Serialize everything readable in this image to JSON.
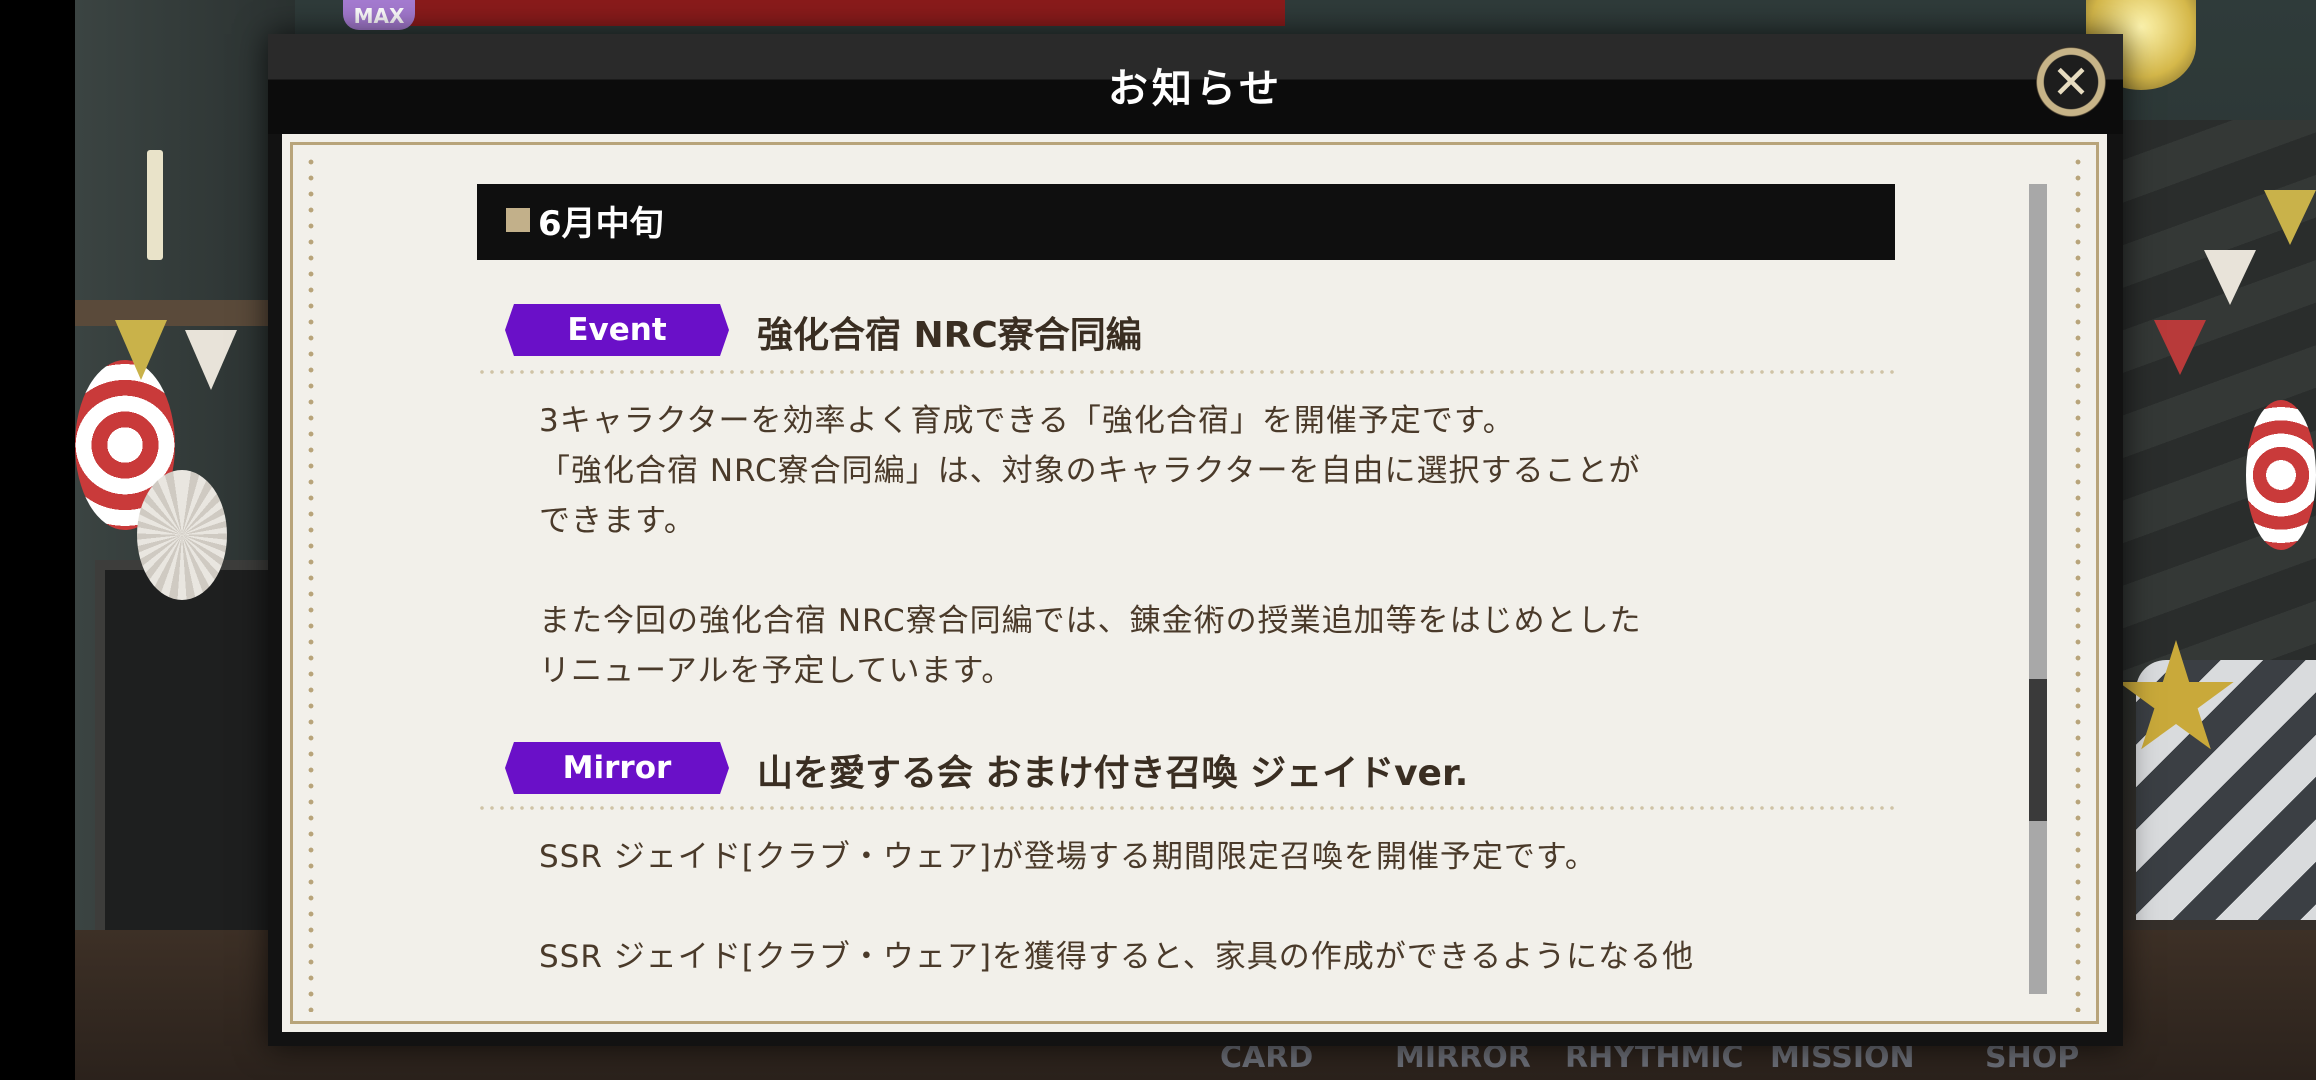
{
  "background": {
    "max_badge": "MAX",
    "bottom_nav": [
      "CARD",
      "MIRROR",
      "RHYTHMIC",
      "MISSION",
      "SHOP"
    ]
  },
  "dialog": {
    "title": "お知らせ",
    "close_icon": "close-icon",
    "date_header": "6月中旬",
    "items": [
      {
        "category": "Event",
        "title": "強化合宿 NRC寮合同編",
        "lines": [
          "3キャラクターを効率よく育成できる「強化合宿」を開催予定です。",
          "「強化合宿 NRC寮合同編」は、対象のキャラクターを自由に選択することが",
          "できます。",
          "",
          "また今回の強化合宿 NRC寮合同編では、錬金術の授業追加等をはじめとした",
          "リニューアルを予定しています。"
        ]
      },
      {
        "category": "Mirror",
        "title": "山を愛する会 おまけ付き召喚 ジェイドver.",
        "lines": [
          "SSR ジェイド[クラブ・ウェア]が登場する期間限定召喚を開催予定です。",
          "",
          "SSR ジェイド[クラブ・ウェア]を獲得すると、家具の作成ができるようになる他"
        ]
      }
    ]
  },
  "colors": {
    "category_badge": "#6a10c8",
    "panel_bg": "#f2f0ea",
    "frame_gold": "#b8a47a",
    "text_brown": "#4a3a2a"
  }
}
